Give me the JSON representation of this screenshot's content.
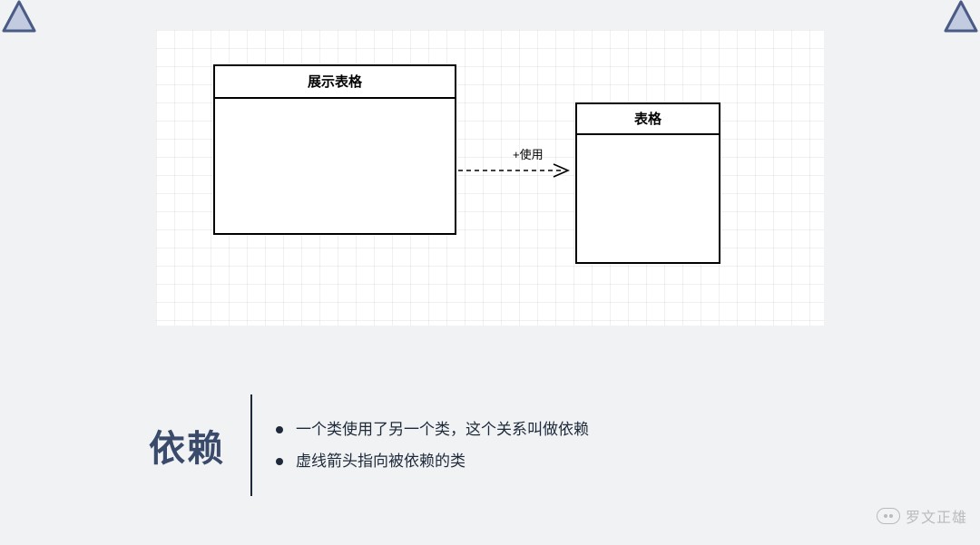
{
  "diagram": {
    "boxes": {
      "left": {
        "title": "展示表格"
      },
      "right": {
        "title": "表格"
      }
    },
    "arrow": {
      "label": "+使用",
      "style": "dashed-open-arrow",
      "from": "展示表格",
      "to": "表格"
    }
  },
  "info": {
    "title": "依赖",
    "bullets": [
      "一个类使用了另一个类，这个关系叫做依赖",
      "虚线箭头指向被依赖的类"
    ]
  },
  "watermark": {
    "text": "罗文正雄"
  }
}
